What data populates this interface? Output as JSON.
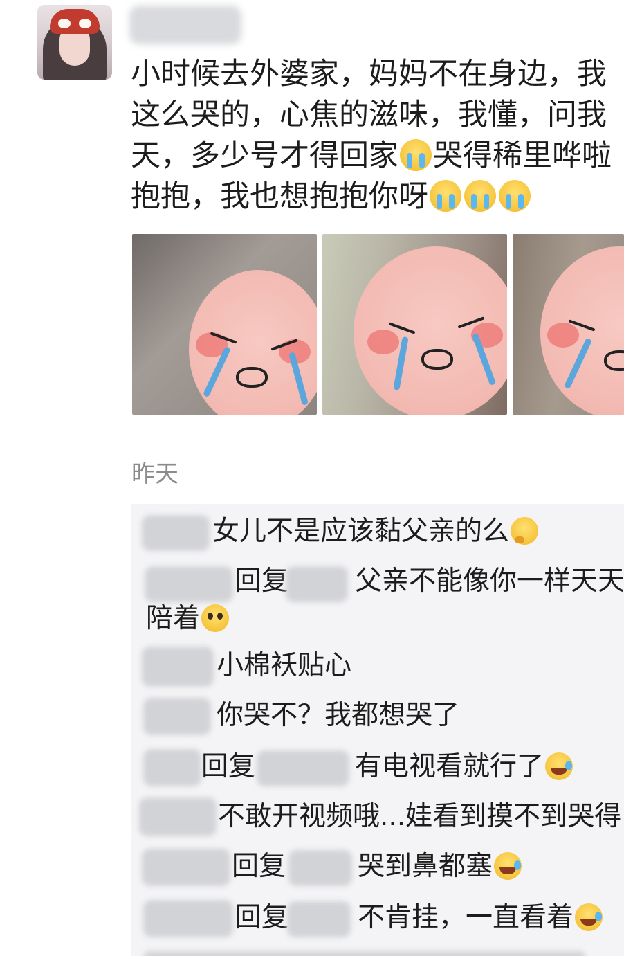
{
  "post": {
    "lines": [
      "小时候去外婆家，妈妈不在身边，我",
      "这么哭的，心焦的滋味，我懂，问我",
      "天，多少号才得回家",
      "哭得稀里哗啦",
      "抱抱，我也想抱抱你呀"
    ],
    "emoji_icons": [
      "crying-emoji",
      "crying-emoji",
      "crying-emoji",
      "crying-emoji"
    ]
  },
  "photos": [
    "photo-1",
    "photo-2",
    "photo-3"
  ],
  "time_label": "昨天",
  "comments": [
    {
      "text": "女儿不是应该黏父亲的么",
      "emoji": "thinking-emoji"
    },
    {
      "reply": "回复",
      "text": "父亲不能像你一样天天",
      "text2": "陪着",
      "emoji": "worried-emoji"
    },
    {
      "text": "小棉袄贴心"
    },
    {
      "text": "你哭不？我都想哭了"
    },
    {
      "reply": "回复",
      "text": "有电视看就行了",
      "emoji": "laugh-cry-emoji"
    },
    {
      "text": "不敢开视频哦...娃看到摸不到哭得"
    },
    {
      "reply": "回复",
      "text": "哭到鼻都塞",
      "emoji": "laugh-cry-emoji"
    },
    {
      "reply": "回复",
      "text": "不肯挂，一直看着",
      "emoji": "laugh-cry-emoji"
    }
  ]
}
